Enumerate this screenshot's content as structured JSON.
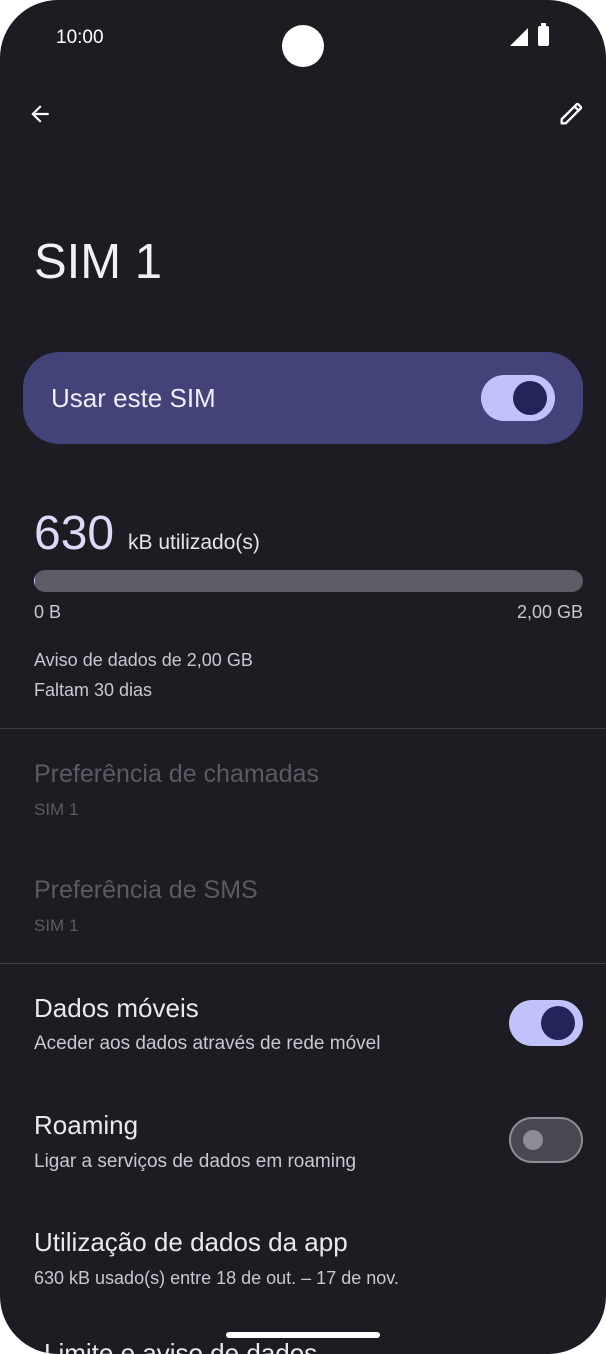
{
  "status_bar": {
    "time": "10:00"
  },
  "header": {
    "title": "SIM 1"
  },
  "use_sim": {
    "label": "Usar este SIM",
    "enabled": true
  },
  "usage": {
    "amount": "630",
    "unit_label": "kB utilizado(s)",
    "bar_fraction": 0.0003,
    "min_label": "0 B",
    "max_label": "2,00 GB",
    "warning": "Aviso de dados de 2,00 GB",
    "remaining": "Faltam 30 dias"
  },
  "calls_pref": {
    "title": "Preferência de chamadas",
    "value": "SIM 1"
  },
  "sms_pref": {
    "title": "Preferência de SMS",
    "value": "SIM 1"
  },
  "mobile_data": {
    "title": "Dados móveis",
    "subtitle": "Aceder aos dados através de rede móvel",
    "enabled": true
  },
  "roaming": {
    "title": "Roaming",
    "subtitle": "Ligar a serviços de dados em roaming",
    "enabled": false
  },
  "app_data_usage": {
    "title": "Utilização de dados da app",
    "subtitle": "630 kB usado(s) entre 18 de out. – 17 de nov."
  },
  "next_item_partial": "Limite e aviso de dados",
  "colors": {
    "background": "#1d1c22",
    "accent": "#c1c2fb",
    "card": "#434379"
  }
}
